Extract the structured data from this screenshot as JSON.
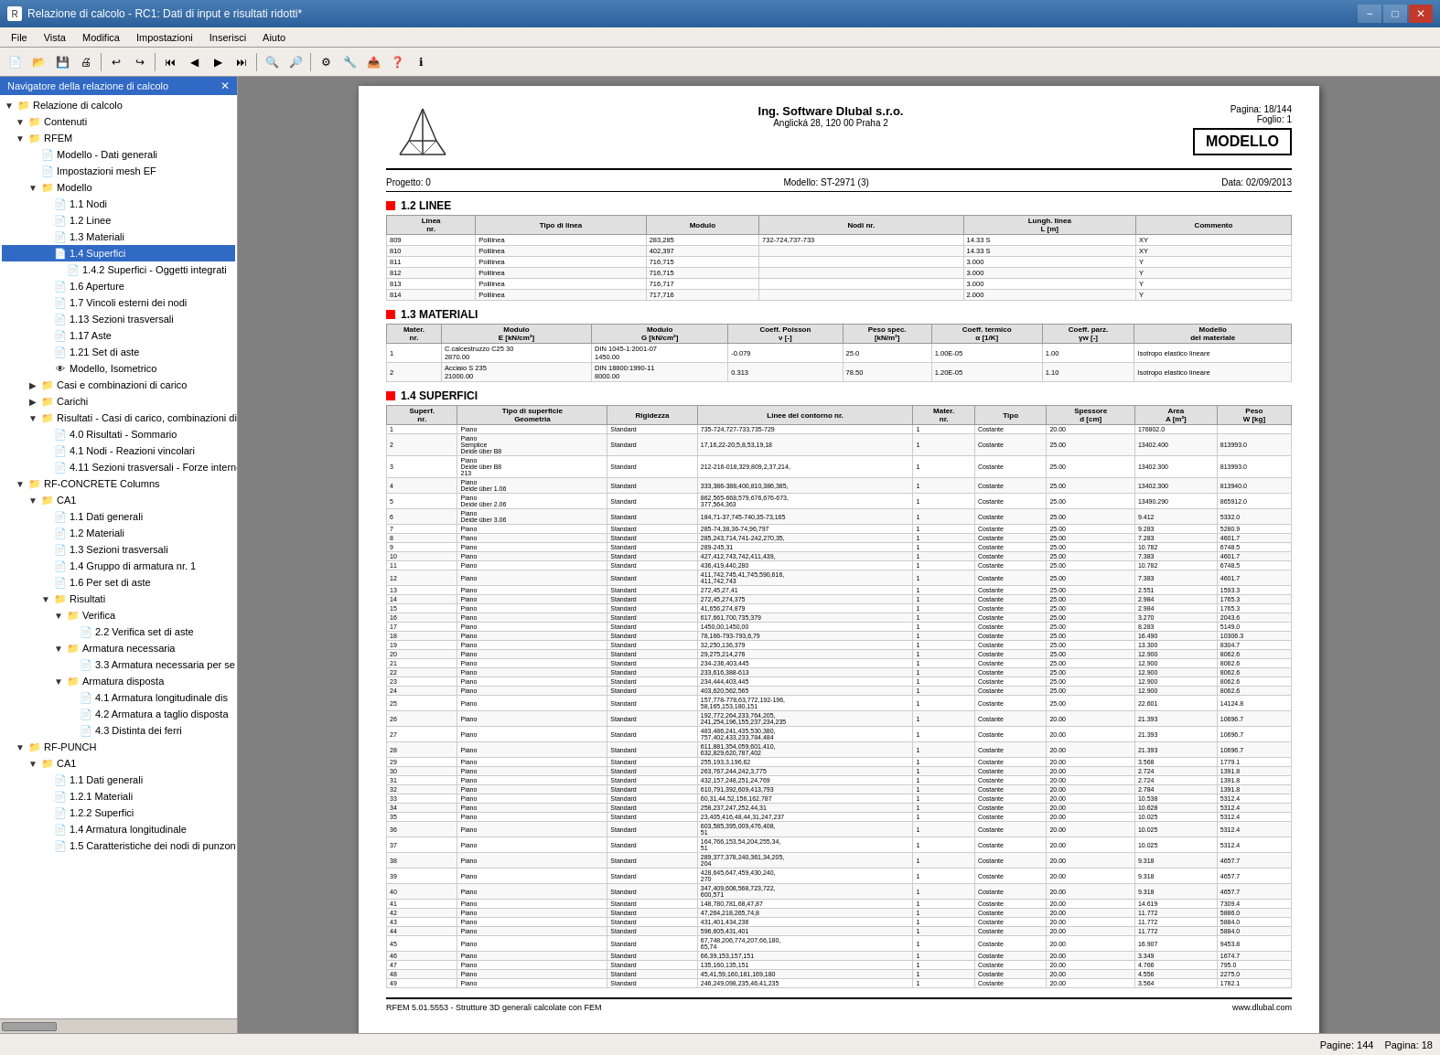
{
  "titleBar": {
    "title": "Relazione di calcolo - RC1: Dati di input e risultati ridotti*",
    "minLabel": "−",
    "maxLabel": "□",
    "closeLabel": "✕"
  },
  "menuBar": {
    "items": [
      "File",
      "Vista",
      "Modifica",
      "Impostazioni",
      "Inserisci",
      "Aiuto"
    ]
  },
  "navigator": {
    "title": "Navigatore della relazione di calcolo",
    "tree": [
      {
        "label": "Relazione di calcolo",
        "indent": 0,
        "type": "folder",
        "expanded": true
      },
      {
        "label": "Contenuti",
        "indent": 1,
        "type": "folder",
        "expanded": true
      },
      {
        "label": "RFEM",
        "indent": 1,
        "type": "folder",
        "expanded": true
      },
      {
        "label": "Modello - Dati generali",
        "indent": 2,
        "type": "doc"
      },
      {
        "label": "Impostazioni mesh EF",
        "indent": 2,
        "type": "doc"
      },
      {
        "label": "Modello",
        "indent": 2,
        "type": "folder",
        "expanded": true
      },
      {
        "label": "1.1 Nodi",
        "indent": 3,
        "type": "doc"
      },
      {
        "label": "1.2 Linee",
        "indent": 3,
        "type": "doc"
      },
      {
        "label": "1.3 Materiali",
        "indent": 3,
        "type": "doc"
      },
      {
        "label": "1.4 Superfici",
        "indent": 3,
        "type": "doc",
        "selected": true
      },
      {
        "label": "1.4.2 Superfici - Oggetti integrati",
        "indent": 4,
        "type": "doc"
      },
      {
        "label": "1.6 Aperture",
        "indent": 3,
        "type": "doc"
      },
      {
        "label": "1.7 Vincoli esterni dei nodi",
        "indent": 3,
        "type": "doc"
      },
      {
        "label": "1.13 Sezioni trasversali",
        "indent": 3,
        "type": "doc"
      },
      {
        "label": "1.17 Aste",
        "indent": 3,
        "type": "doc"
      },
      {
        "label": "1.21 Set di aste",
        "indent": 3,
        "type": "doc"
      },
      {
        "label": "Modello, Isometrico",
        "indent": 3,
        "type": "eye"
      },
      {
        "label": "Casi e combinazioni di carico",
        "indent": 2,
        "type": "folder"
      },
      {
        "label": "Carichi",
        "indent": 2,
        "type": "folder"
      },
      {
        "label": "Risultati - Casi di carico, combinazioni di",
        "indent": 2,
        "type": "folder"
      },
      {
        "label": "4.0 Risultati - Sommario",
        "indent": 3,
        "type": "doc"
      },
      {
        "label": "4.1 Nodi - Reazioni vincolari",
        "indent": 3,
        "type": "doc"
      },
      {
        "label": "4.11 Sezioni trasversali - Forze interne",
        "indent": 3,
        "type": "doc"
      },
      {
        "label": "RF-CONCRETE Columns",
        "indent": 1,
        "type": "folder",
        "expanded": true
      },
      {
        "label": "CA1",
        "indent": 2,
        "type": "folder",
        "expanded": true
      },
      {
        "label": "1.1 Dati generali",
        "indent": 3,
        "type": "doc"
      },
      {
        "label": "1.2 Materiali",
        "indent": 3,
        "type": "doc"
      },
      {
        "label": "1.3 Sezioni trasversali",
        "indent": 3,
        "type": "doc"
      },
      {
        "label": "1.4 Gruppo di armatura nr. 1",
        "indent": 3,
        "type": "doc"
      },
      {
        "label": "1.6 Per set di aste",
        "indent": 3,
        "type": "doc"
      },
      {
        "label": "Risultati",
        "indent": 3,
        "type": "folder",
        "expanded": true
      },
      {
        "label": "Verifica",
        "indent": 4,
        "type": "folder",
        "expanded": true
      },
      {
        "label": "2.2 Verifica set di aste",
        "indent": 5,
        "type": "doc"
      },
      {
        "label": "Armatura necessaria",
        "indent": 4,
        "type": "folder",
        "expanded": true
      },
      {
        "label": "3.3 Armatura necessaria per se",
        "indent": 5,
        "type": "doc"
      },
      {
        "label": "Armatura disposta",
        "indent": 4,
        "type": "folder",
        "expanded": true
      },
      {
        "label": "4.1 Armatura longitudinale dis",
        "indent": 5,
        "type": "doc"
      },
      {
        "label": "4.2 Armatura a taglio disposta",
        "indent": 5,
        "type": "doc"
      },
      {
        "label": "4.3 Distinta dei ferri",
        "indent": 5,
        "type": "doc"
      },
      {
        "label": "RF-PUNCH",
        "indent": 1,
        "type": "folder",
        "expanded": true
      },
      {
        "label": "CA1",
        "indent": 2,
        "type": "folder",
        "expanded": true
      },
      {
        "label": "1.1 Dati generali",
        "indent": 3,
        "type": "doc"
      },
      {
        "label": "1.2.1 Materiali",
        "indent": 3,
        "type": "doc"
      },
      {
        "label": "1.2.2 Superfici",
        "indent": 3,
        "type": "doc"
      },
      {
        "label": "1.4 Armatura longitudinale",
        "indent": 3,
        "type": "doc"
      },
      {
        "label": "1.5 Caratteristiche dei nodi di punzon",
        "indent": 3,
        "type": "doc"
      }
    ]
  },
  "document": {
    "company": "Ing. Software Dlubal s.r.o.",
    "address": "Anglická 28, 120 00 Praha 2",
    "pageLabel": "Pagina:",
    "pageValue": "18/144",
    "foglioLabel": "Foglio:",
    "foglioValue": "1",
    "modelBadge": "MODELLO",
    "projectLabel": "Progetto:",
    "projectValue": "0",
    "modelLabel": "Modello:",
    "modelValue": "ST-2971 (3)",
    "dataLabel": "Data:",
    "dataValue": "02/09/2013",
    "section12": {
      "title": "1.2 LINEE",
      "headers": [
        "Linea nr.",
        "Tipo di linea",
        "Modulo",
        "Nodi nr.",
        "Lungh. linea L [m]",
        "Commento"
      ],
      "rows": [
        [
          "809",
          "Polilinea",
          "283,285",
          "732-724,737-733",
          "14.33 S",
          "XY"
        ],
        [
          "810",
          "Polilinea",
          "402,397",
          "",
          "14.33 S",
          "XY"
        ],
        [
          "811",
          "Polilinea",
          "716,715",
          "",
          "3.000",
          "Y"
        ],
        [
          "812",
          "Polilinea",
          "716,715",
          "",
          "3.000",
          "Y"
        ],
        [
          "813",
          "Polilinea",
          "716,717",
          "",
          "3.000",
          "Y"
        ],
        [
          "814",
          "Polilinea",
          "717,716",
          "",
          "2.000",
          "Y"
        ]
      ]
    },
    "section13": {
      "title": "1.3 MATERIALI",
      "headers": [
        "Mater. nr.",
        "Modulo E [kN/cm²]",
        "Modulo G [kN/cm²]",
        "Coeff. Poisson ν [-]",
        "Peso spec. [kN/m³]",
        "Coeff. termico α [1/K]",
        "Coeff. parz. γw [-]",
        "Modello del materiale"
      ],
      "rows": [
        [
          "1",
          "C.calcestruzzo C25 30",
          "DIN 1045-1:2001-07",
          "",
          "-0.079",
          "25.0",
          "1.00E-05",
          "1.00",
          "Isotropo elastico lineare"
        ],
        [
          "2",
          "Acciaio S 235",
          "DIN 18800:1990-11",
          "21000.00",
          "0.313",
          "78.50",
          "1.20E-05",
          "1.10",
          "Isotropo elastico lineare"
        ]
      ]
    },
    "section14": {
      "title": "1.4 SUPERFICI",
      "headers": [
        "Superf. nr.",
        "Tipo di superficie Geometria",
        "Rigidezza",
        "Linee del contorno nr.",
        "Mater. nr.",
        "Tipo",
        "Spessore d [cm]",
        "Area A [m²]",
        "Peso W [kg]"
      ],
      "rows": [
        [
          "1",
          "Piano",
          "Standard",
          "735-724,727-733,735-729",
          "1",
          "Costante",
          "20.00",
          "176802.0",
          ""
        ],
        [
          "2",
          "Piano\nSemplice\nDeide über B8",
          "Standard",
          "17,16,22-20,5,8,53,19,18",
          "1",
          "Costante",
          "25.00",
          "13402.400",
          "813993.0"
        ],
        [
          "3",
          "Piano\nDeide über B8\n213",
          "Standard",
          "212-216-018,329,809,2,37,214,",
          "1",
          "Costante",
          "25.00",
          "13402.300",
          "813993.0"
        ],
        [
          "4",
          "Piano\nDeide über 1.06",
          "Standard",
          "333,386-388,400,810,386,385,",
          "1",
          "Costante",
          "25.00",
          "13402.300",
          "813940.0"
        ],
        [
          "5",
          "Piano\nDeide über 2.06",
          "Standard",
          "862,565-668,579,676,676-673,\n377,564,363",
          "1",
          "Costante",
          "25.00",
          "13490.290",
          "865912.0"
        ],
        [
          "6",
          "Piano\nDeide über 3.06",
          "Standard",
          "184,71-37,745-740,35-73,165",
          "1",
          "Costante",
          "25.00",
          "9.412",
          "5332.0"
        ],
        [
          "7",
          "Piano",
          "Standard",
          "285-74,38,36-74,96,797",
          "1",
          "Costante",
          "25.00",
          "9.283",
          "5280.9"
        ],
        [
          "8",
          "Piano",
          "Standard",
          "285,243,714,741-242,270,35,",
          "1",
          "Costante",
          "25.00",
          "7.283",
          "4601.7"
        ],
        [
          "9",
          "Piano",
          "Standard",
          "289-245,31",
          "1",
          "Costante",
          "25.00",
          "10.782",
          "6748.5"
        ],
        [
          "10",
          "Piano",
          "Standard",
          "427,412,743,742,411,439,",
          "1",
          "Costante",
          "25.00",
          "7.383",
          "4601.7"
        ],
        [
          "11",
          "Piano",
          "Standard",
          "436,419,440,280",
          "1",
          "Costante",
          "25.00",
          "10.782",
          "6748.5"
        ],
        [
          "12",
          "Piano",
          "Standard",
          "411,742,745,41,745,590,616,\n411,742,743",
          "1",
          "Costante",
          "25.00",
          "7.383",
          "4601.7"
        ],
        [
          "13",
          "Piano",
          "Standard",
          "272,45,27,41",
          "1",
          "Costante",
          "25.00",
          "2.551",
          "1593.3"
        ],
        [
          "14",
          "Piano",
          "Standard",
          "272,45,274,375",
          "1",
          "Costante",
          "25.00",
          "2.984",
          "1765.3"
        ],
        [
          "15",
          "Piano",
          "Standard",
          "41,656,274,879",
          "1",
          "Costante",
          "25.00",
          "2.984",
          "1765.3"
        ],
        [
          "16",
          "Piano",
          "Standard",
          "617,661,700,735,379",
          "1",
          "Costante",
          "25.00",
          "3.270",
          "2043.6"
        ],
        [
          "17",
          "Piano",
          "Standard",
          "1450,00,1450,00",
          "1",
          "Costante",
          "25.00",
          "8.283",
          "5149.0"
        ],
        [
          "18",
          "Piano",
          "Standard",
          "78,166-793-793,6,79",
          "1",
          "Costante",
          "25.00",
          "16.490",
          "10306.3"
        ],
        [
          "19",
          "Piano",
          "Standard",
          "32,250,136,379",
          "1",
          "Costante",
          "25.00",
          "13.300",
          "8304.7"
        ],
        [
          "20",
          "Piano",
          "Standard",
          "29,275,214,276",
          "1",
          "Costante",
          "25.00",
          "12.900",
          "8062.6"
        ],
        [
          "21",
          "Piano",
          "Standard",
          "234-236,403,445",
          "1",
          "Costante",
          "25.00",
          "12.900",
          "8062.6"
        ],
        [
          "22",
          "Piano",
          "Standard",
          "233,616,388-613",
          "1",
          "Costante",
          "25.00",
          "12.900",
          "8062.6"
        ],
        [
          "23",
          "Piano",
          "Standard",
          "234,444,403,445",
          "1",
          "Costante",
          "25.00",
          "12.900",
          "8062.6"
        ],
        [
          "24",
          "Piano",
          "Standard",
          "403,620,562,565",
          "1",
          "Costante",
          "25.00",
          "12.900",
          "8062.6"
        ],
        [
          "25",
          "Piano",
          "Standard",
          "157,778-778,63,772,192-196,\n58,165,153,180,151",
          "1",
          "Costante",
          "25.00",
          "22.601",
          "14124.8"
        ],
        [
          "26",
          "Piano",
          "Standard",
          "192,772,264,233,764,205,\n241,254,196,155,237,234,235",
          "1",
          "Costante",
          "20.00",
          "21.393",
          "10696.7"
        ],
        [
          "27",
          "Piano",
          "Standard",
          "483,486,241,435,530,380,\n757,402,433,233,784,484",
          "1",
          "Costante",
          "20.00",
          "21.393",
          "10696.7"
        ],
        [
          "28",
          "Piano",
          "Standard",
          "611,881,354,059,601,410,\n632,829,620,787,402",
          "1",
          "Costante",
          "20.00",
          "21.393",
          "10696.7"
        ],
        [
          "29",
          "Piano",
          "Standard",
          "255,193,3,196,62",
          "1",
          "Costante",
          "20.00",
          "3.568",
          "1779.1"
        ],
        [
          "30",
          "Piano",
          "Standard",
          "263,767,244,242,3,775",
          "1",
          "Costante",
          "20.00",
          "2.724",
          "1391.8"
        ],
        [
          "31",
          "Piano",
          "Standard",
          "432,157,248,251,24,769",
          "1",
          "Costante",
          "20.00",
          "2.724",
          "1391.8"
        ],
        [
          "32",
          "Piano",
          "Standard",
          "610,791,392,609,413,793",
          "1",
          "Costante",
          "20.00",
          "2.784",
          "1391.8"
        ],
        [
          "33",
          "Piano",
          "Standard",
          "60,31,44,52,156,162,787",
          "1",
          "Costante",
          "20.00",
          "10.538",
          "5312.4"
        ],
        [
          "34",
          "Piano",
          "Standard",
          "258,237,247,252,44,31",
          "1",
          "Costante",
          "20.00",
          "10.628",
          "5312.4"
        ],
        [
          "35",
          "Piano",
          "Standard",
          "23,405,416,48,44,31,247,237",
          "1",
          "Costante",
          "20.00",
          "10.025",
          "5312.4"
        ],
        [
          "36",
          "Piano",
          "Standard",
          "603,585,395,009,476,408,\n51",
          "1",
          "Costante",
          "20.00",
          "10.025",
          "5312.4"
        ],
        [
          "37",
          "Piano",
          "Standard",
          "164,766,153,54,204,255,34,\n51",
          "1",
          "Costante",
          "20.00",
          "10.025",
          "5312.4"
        ],
        [
          "38",
          "Piano",
          "Standard",
          "289,377,378,240,361,34,205,\n204",
          "1",
          "Costante",
          "20.00",
          "9.318",
          "4657.7"
        ],
        [
          "39",
          "Piano",
          "Standard",
          "428,645,647,459,430,240,\n270",
          "1",
          "Costante",
          "20.00",
          "9.318",
          "4657.7"
        ],
        [
          "40",
          "Piano",
          "Standard",
          "347,409,608,568,723,722,\n600,571",
          "1",
          "Costante",
          "20.00",
          "9.318",
          "4657.7"
        ],
        [
          "41",
          "Piano",
          "Standard",
          "148,780,781,68,47,87",
          "1",
          "Costante",
          "20.00",
          "14.619",
          "7309.4"
        ],
        [
          "42",
          "Piano",
          "Standard",
          "47,264,218,265,74,8",
          "1",
          "Costante",
          "20.00",
          "11.772",
          "5886.0"
        ],
        [
          "43",
          "Piano",
          "Standard",
          "431,401,434,236",
          "1",
          "Costante",
          "20.00",
          "11.772",
          "5884.0"
        ],
        [
          "44",
          "Piano",
          "Standard",
          "596,605,431,401",
          "1",
          "Costante",
          "20.00",
          "11.772",
          "5884.0"
        ],
        [
          "45",
          "Piano",
          "Standard",
          "67,748,206,774,207,66,180,\n65,74",
          "1",
          "Costante",
          "20.00",
          "16.907",
          "9453.8"
        ],
        [
          "46",
          "Piano",
          "Standard",
          "66,39,153,157,151",
          "1",
          "Costante",
          "20.00",
          "3.349",
          "1674.7"
        ],
        [
          "47",
          "Piano",
          "Standard",
          "135,160,135,151",
          "1",
          "Costante",
          "20.00",
          "4.766",
          "795.0"
        ],
        [
          "48",
          "Piano",
          "Standard",
          "45,41,59,160,181,169,180",
          "1",
          "Costante",
          "20.00",
          "4.556",
          "2275.0"
        ],
        [
          "49",
          "Piano",
          "Standard",
          "246,249,098,235,46,41,235",
          "1",
          "Costante",
          "20.00",
          "3.564",
          "1782.1"
        ]
      ]
    }
  },
  "footer": {
    "left": "RFEM 5.01.5553 - Strutture 3D generali calcolate con FEM",
    "right": "www.dlubal.com"
  },
  "statusBar": {
    "leftText": "",
    "pagesLabel": "Pagine:",
    "pagesValue": "144",
    "pageLabel": "Pagina:",
    "pageValue": "18"
  }
}
